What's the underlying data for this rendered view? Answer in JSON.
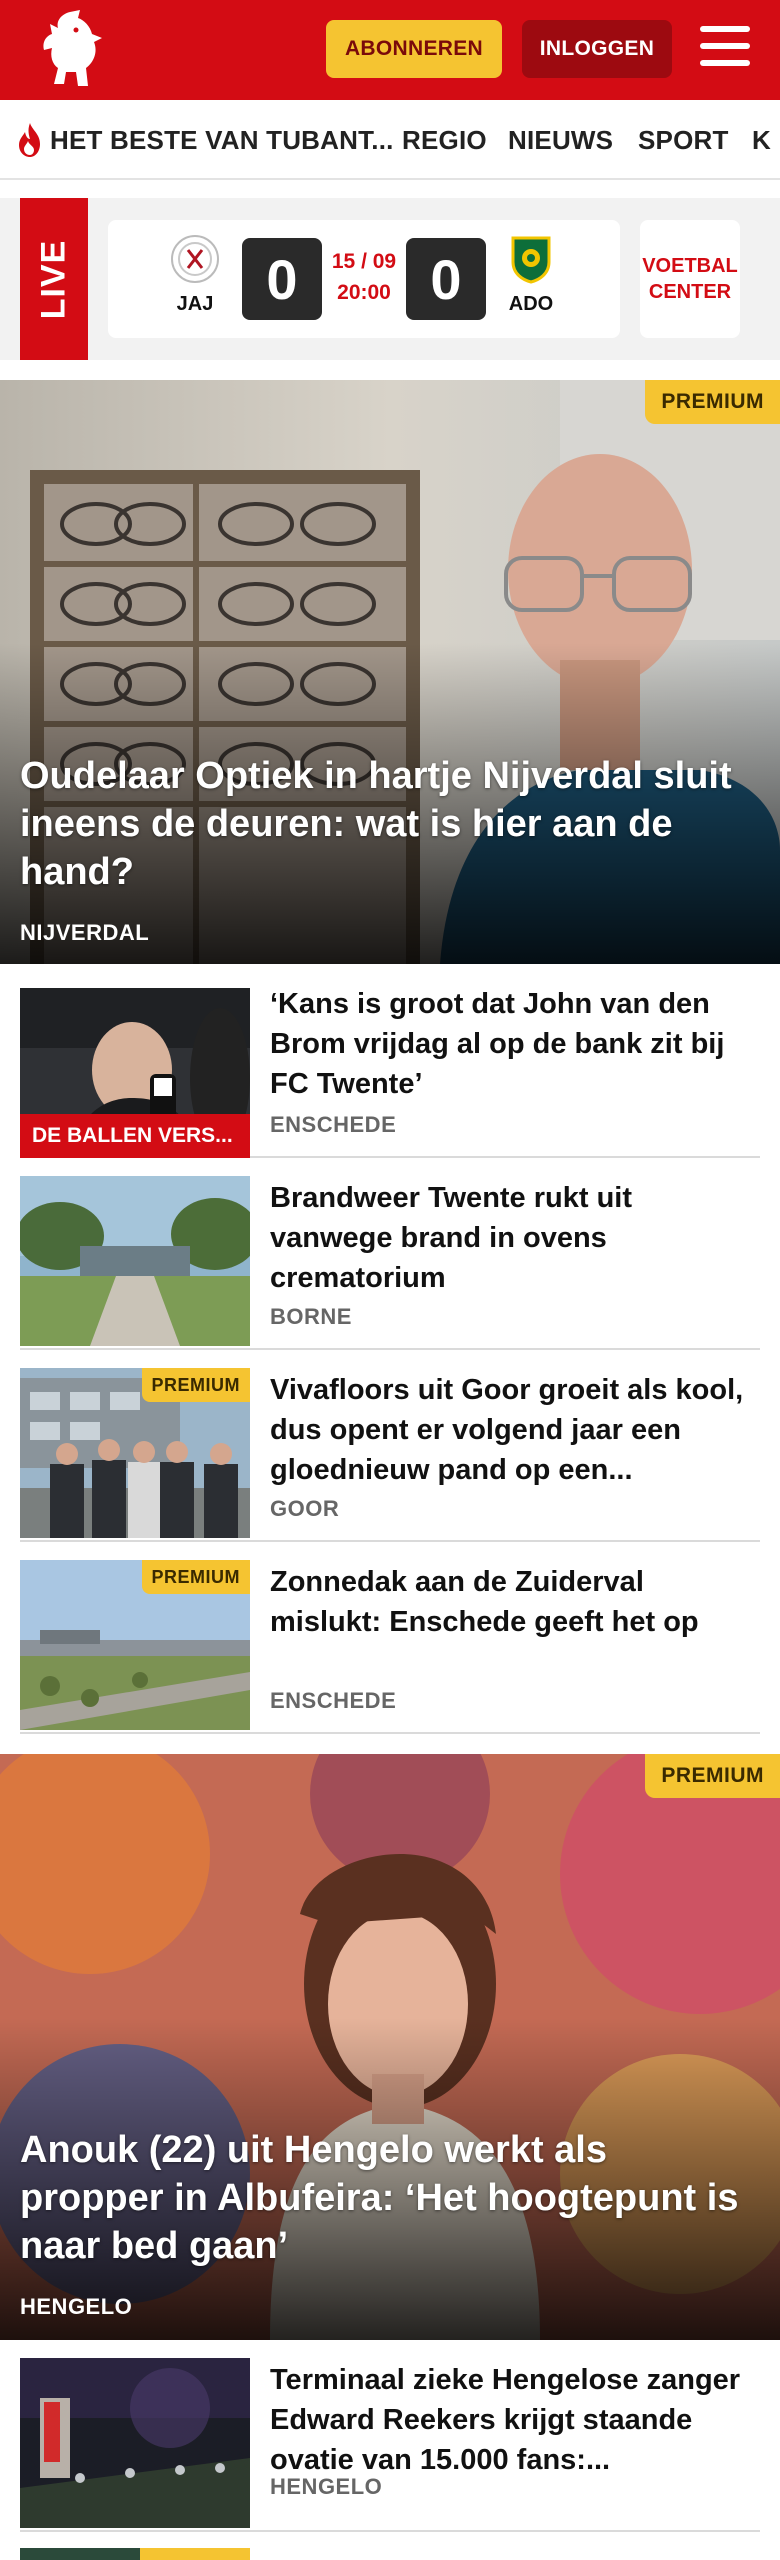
{
  "header": {
    "subscribe_label": "ABONNEREN",
    "login_label": "INLOGGEN",
    "logo_icon": "tubantia-horse-logo",
    "menu_icon": "hamburger-menu-icon",
    "brand_color": "#d30c14",
    "accent_color": "#f5c431"
  },
  "nav": {
    "items": [
      {
        "label": "HET BESTE VAN TUBANT..."
      },
      {
        "label": "REGIO"
      },
      {
        "label": "NIEUWS"
      },
      {
        "label": "SPORT"
      },
      {
        "label": "K"
      }
    ]
  },
  "live": {
    "tag": "LIVE",
    "home_team": "JAJ",
    "away_team": "ADO",
    "home_score": "0",
    "away_score": "0",
    "date": "15 / 09",
    "time": "20:00",
    "voetbal_center": "VOETBAL CENTER"
  },
  "articles": {
    "hero1": {
      "title": "Oudelaar Optiek in hartje Nijverdal sluit ineens de deuren: wat is hier aan de hand?",
      "location": "NIJVERDAL",
      "badge": "PREMIUM"
    },
    "list1": [
      {
        "title": "‘Kans is groot dat John van den Brom vrijdag al op de bank zit bij FC Twente’",
        "location": "ENSCHEDE",
        "label": "DE BALLEN VERS..."
      },
      {
        "title": "Brandweer Twente rukt uit vanwege brand in ovens crematorium",
        "location": "BORNE"
      },
      {
        "title": "Vivafloors uit Goor groeit als kool, dus opent er volgend jaar een gloednieuw pand op een...",
        "location": "GOOR",
        "badge": "PREMIUM"
      },
      {
        "title": "Zonnedak aan de Zuiderval mislukt: Enschede geeft het op",
        "location": "ENSCHEDE",
        "badge": "PREMIUM"
      }
    ],
    "hero2": {
      "title": "Anouk (22) uit Hengelo werkt als propper in Albufeira: ‘Het hoogtepunt is naar bed gaan’",
      "location": "HENGELO",
      "badge": "PREMIUM"
    },
    "list2": [
      {
        "title": "Terminaal zieke Hengelose zanger Edward Reekers krijgt staande ovatie van 15.000 fans:...",
        "location": "HENGELO"
      }
    ]
  }
}
